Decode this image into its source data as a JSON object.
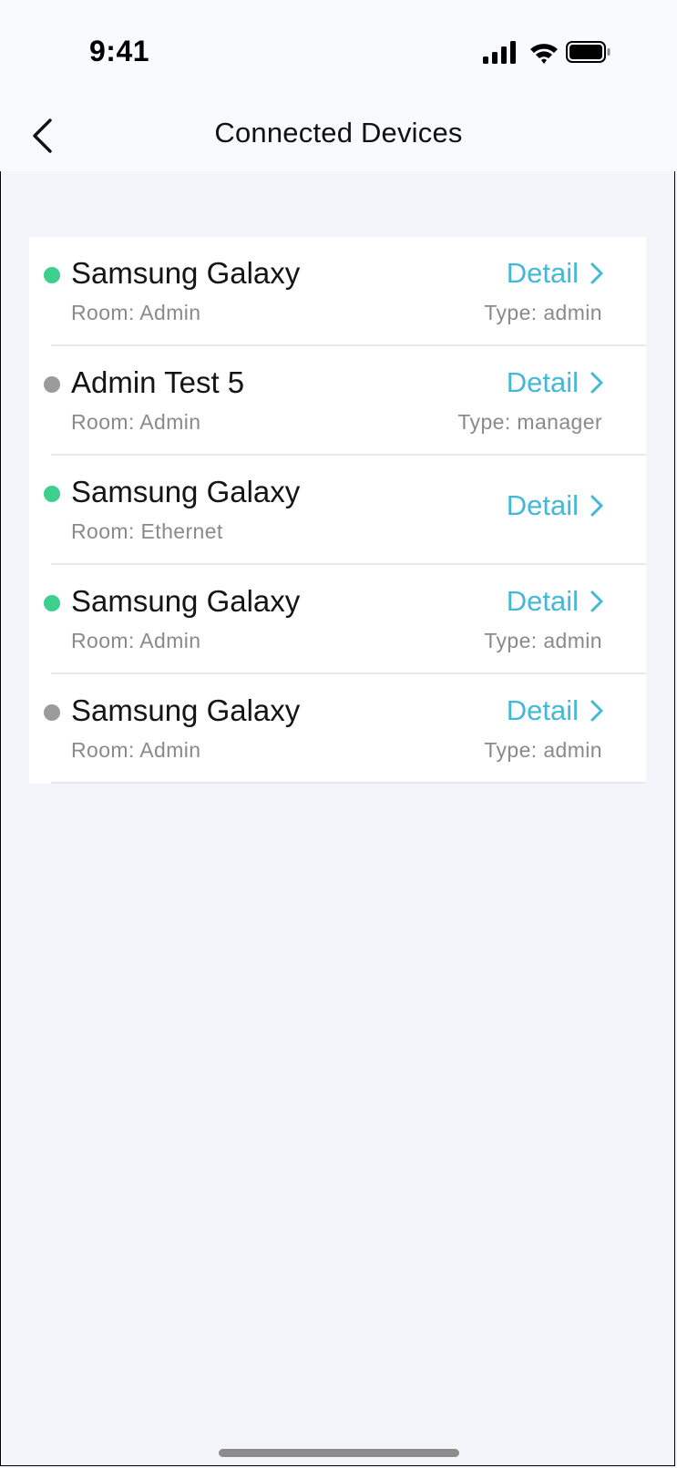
{
  "status_bar": {
    "time": "9:41"
  },
  "header": {
    "title": "Connected Devices"
  },
  "devices": [
    {
      "name": "Samsung Galaxy",
      "room": "Room: Admin",
      "type": "Type: admin",
      "status": "online",
      "detail": "Detail"
    },
    {
      "name": "Admin Test 5",
      "room": "Room: Admin",
      "type": "Type: manager",
      "status": "offline",
      "detail": "Detail"
    },
    {
      "name": "Samsung Galaxy",
      "room": "Room: Ethernet",
      "type": "",
      "status": "online",
      "detail": "Detail"
    },
    {
      "name": "Samsung Galaxy",
      "room": "Room: Admin",
      "type": "Type: admin",
      "status": "online",
      "detail": "Detail"
    },
    {
      "name": "Samsung Galaxy",
      "room": "Room: Admin",
      "type": "Type: admin",
      "status": "offline",
      "detail": "Detail"
    }
  ],
  "colors": {
    "online": "#3ecf8e",
    "offline": "#9b9b9b",
    "accent": "#43b8d8",
    "background": "#f3f5fa"
  },
  "icons": {
    "back": "chevron-left-icon",
    "detail": "chevron-right-icon",
    "signal": "cellular-signal-icon",
    "wifi": "wifi-icon",
    "battery": "battery-icon"
  }
}
